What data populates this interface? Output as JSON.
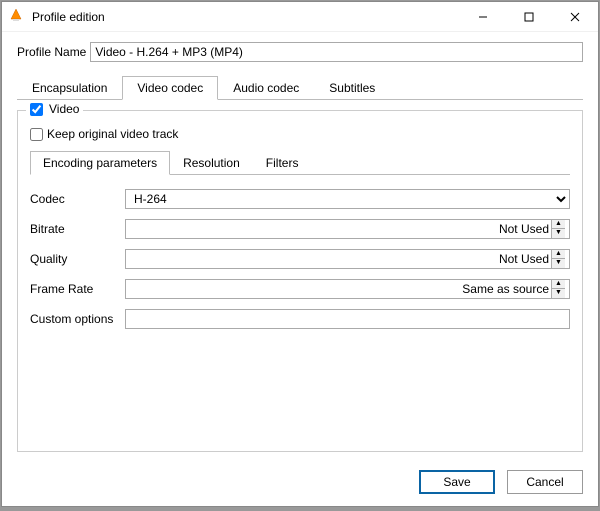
{
  "window": {
    "title": "Profile edition"
  },
  "profile_name": {
    "label": "Profile Name",
    "value": "Video - H.264 + MP3 (MP4)"
  },
  "tabs": {
    "encapsulation": "Encapsulation",
    "video_codec": "Video codec",
    "audio_codec": "Audio codec",
    "subtitles": "Subtitles"
  },
  "video": {
    "checkbox_label": "Video",
    "keep_original": "Keep original video track"
  },
  "subtabs": {
    "encoding": "Encoding parameters",
    "resolution": "Resolution",
    "filters": "Filters"
  },
  "fields": {
    "codec": {
      "label": "Codec",
      "value": "H-264"
    },
    "bitrate": {
      "label": "Bitrate",
      "value": "Not Used"
    },
    "quality": {
      "label": "Quality",
      "value": "Not Used"
    },
    "framerate": {
      "label": "Frame Rate",
      "value": "Same as source"
    },
    "custom": {
      "label": "Custom options",
      "value": ""
    }
  },
  "buttons": {
    "save": "Save",
    "cancel": "Cancel"
  }
}
